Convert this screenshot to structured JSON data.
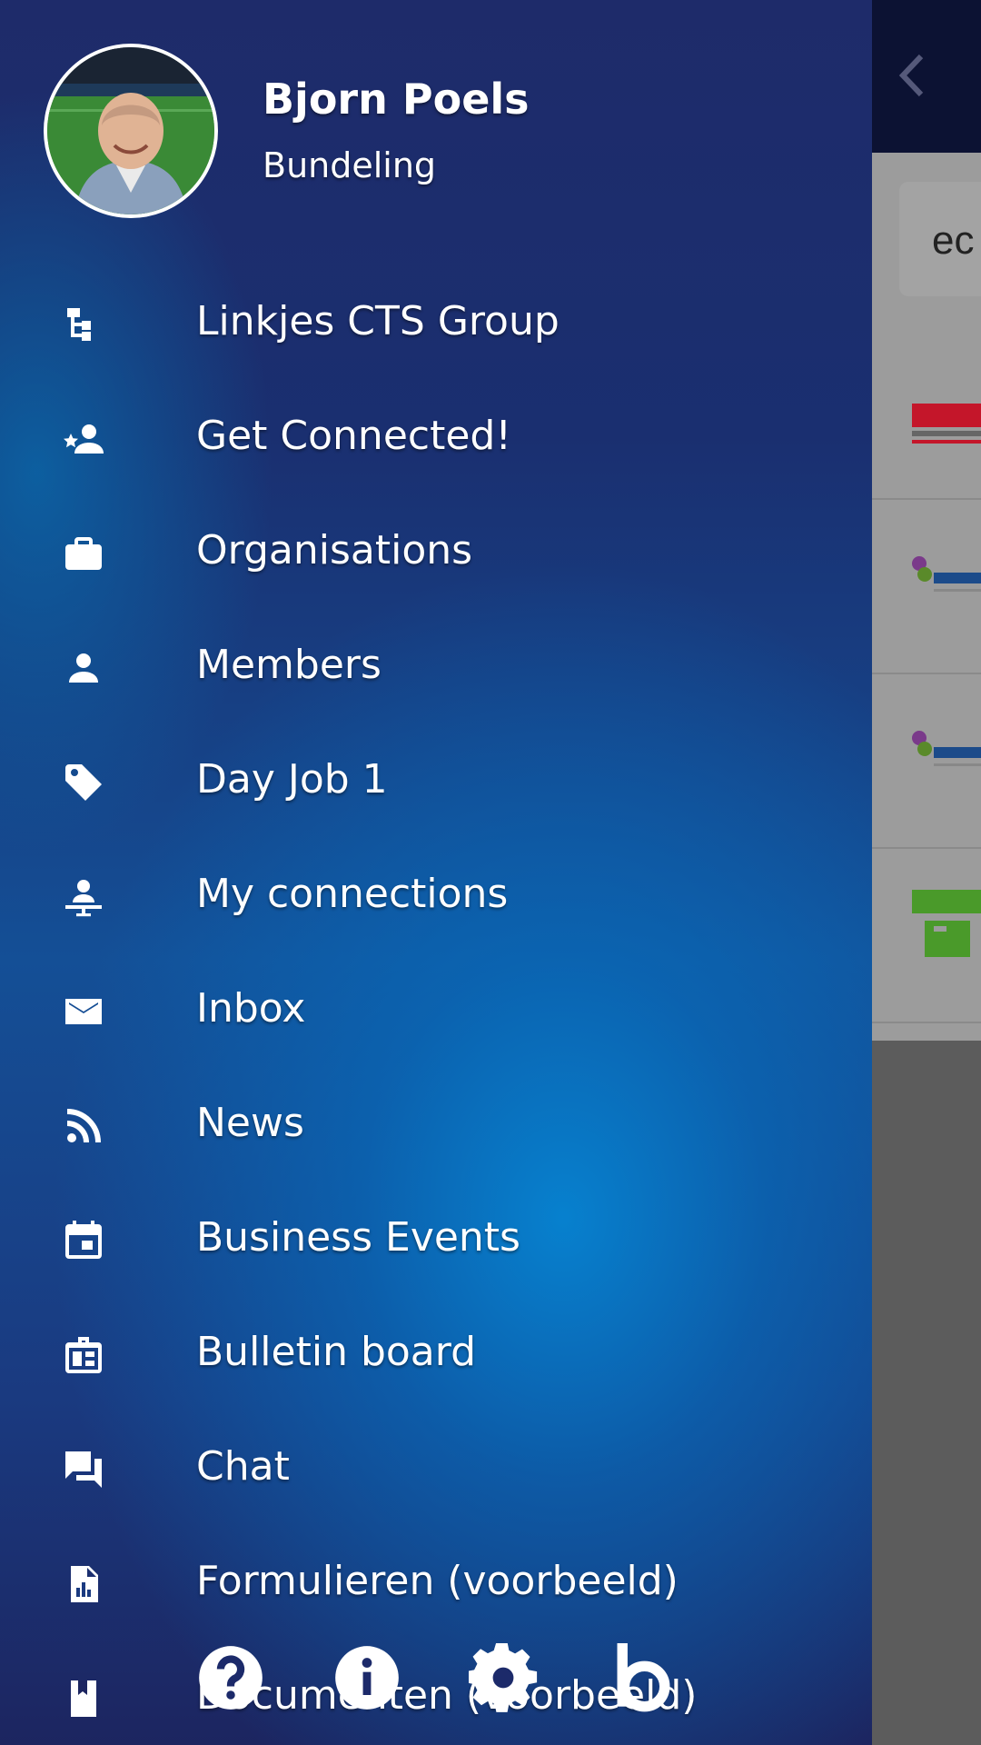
{
  "user": {
    "name": "Bjorn Poels",
    "subtitle": "Bundeling"
  },
  "menu": {
    "items": [
      {
        "label": "Linkjes CTS Group",
        "icon": "tree-icon"
      },
      {
        "label": "Get Connected!",
        "icon": "person-star-icon"
      },
      {
        "label": "Organisations",
        "icon": "briefcase-icon"
      },
      {
        "label": "Members",
        "icon": "person-icon"
      },
      {
        "label": "Day Job 1",
        "icon": "tag-icon"
      },
      {
        "label": "My connections",
        "icon": "person-connect-icon"
      },
      {
        "label": "Inbox",
        "icon": "mail-icon"
      },
      {
        "label": "News",
        "icon": "rss-icon"
      },
      {
        "label": "Business Events",
        "icon": "calendar-icon"
      },
      {
        "label": "Bulletin board",
        "icon": "bulletin-board-icon"
      },
      {
        "label": "Chat",
        "icon": "chat-icon"
      },
      {
        "label": "Formulieren (voorbeeld)",
        "icon": "report-icon"
      },
      {
        "label": "Documenten (voorbeeld)",
        "icon": "book-icon"
      }
    ]
  },
  "footer": {
    "buttons": [
      "help-icon",
      "info-icon",
      "settings-icon",
      "brand-b-icon"
    ]
  },
  "background_app": {
    "search_text": "ec"
  },
  "colors": {
    "drawer_top": "#1e2b6a",
    "drawer_glow": "#0684d2",
    "text": "#ffffff",
    "toolbar": "#0c1233"
  }
}
